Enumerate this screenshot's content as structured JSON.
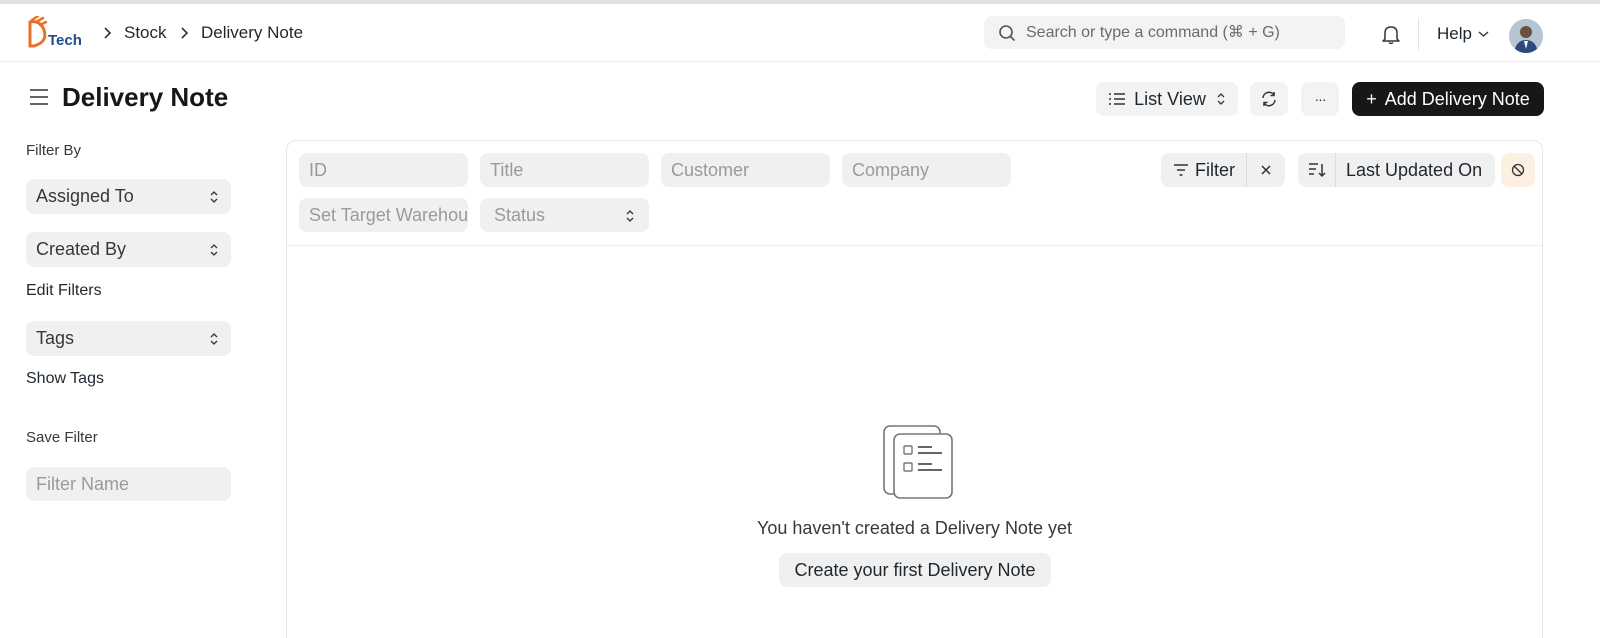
{
  "brand": {
    "logo_text": "Tech",
    "logo_icon": "d-tech-logo"
  },
  "breadcrumbs": [
    "Stock",
    "Delivery Note"
  ],
  "search": {
    "placeholder": "Search or type a command (⌘ + G)"
  },
  "navbar": {
    "help_label": "Help",
    "notification_icon": "bell-icon"
  },
  "page": {
    "title": "Delivery Note"
  },
  "toolbar": {
    "view_label": "List View",
    "add_label": "Add Delivery Note",
    "add_prefix": "+",
    "more_label": "···"
  },
  "sidebar": {
    "filter_by_label": "Filter By",
    "selects": [
      "Assigned To",
      "Created By"
    ],
    "edit_filters_label": "Edit Filters",
    "tags_label": "Tags",
    "show_tags_label": "Show Tags",
    "save_filter_label": "Save Filter",
    "filter_name_placeholder": "Filter Name"
  },
  "list_filters": {
    "fields": [
      "ID",
      "Title",
      "Customer",
      "Company",
      "Set Target Warehouse"
    ],
    "status_label": "Status",
    "filter_label": "Filter",
    "sort_label": "Last Updated On"
  },
  "empty_state": {
    "message": "You haven't created a Delivery Note yet",
    "button_label": "Create your first Delivery Note"
  },
  "colors": {
    "primary_button": "#171717",
    "input_bg": "#f0f0f0",
    "accent_orange": "#fdf0e3"
  }
}
